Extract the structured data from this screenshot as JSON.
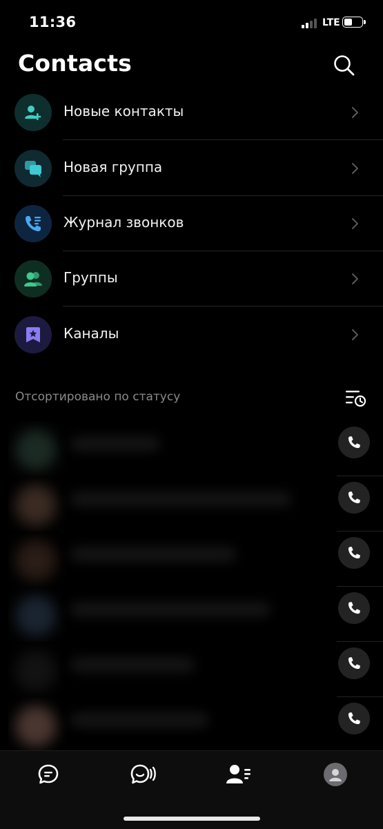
{
  "status_bar": {
    "time": "11:36",
    "network": "LTE",
    "battery_level": 0.4
  },
  "header": {
    "title": "Contacts",
    "search_icon": "search-icon"
  },
  "menu": {
    "items": [
      {
        "label": "Новые контакты",
        "icon": "add-contact-icon",
        "icon_color": "#3ecfc0",
        "bg": "#0f2e2e"
      },
      {
        "label": "Новая группа",
        "icon": "new-group-chat-icon",
        "icon_color": "#3ec9d6",
        "bg": "#0f2a30"
      },
      {
        "label": "Журнал звонков",
        "icon": "call-log-icon",
        "icon_color": "#4aa8f0",
        "bg": "#0e2540"
      },
      {
        "label": "Группы",
        "icon": "groups-icon",
        "icon_color": "#3ec98e",
        "bg": "#0f2e22"
      },
      {
        "label": "Каналы",
        "icon": "channels-icon",
        "icon_color": "#8a7cf0",
        "bg": "#1d1a40"
      }
    ]
  },
  "contacts_section": {
    "sort_label": "Отсортировано по статусу",
    "sort_icon": "sort-by-status-icon",
    "contacts": [
      {
        "avatar_color": "#1c2a24",
        "blurred": true
      },
      {
        "avatar_color": "#3a2a22",
        "blurred": true
      },
      {
        "avatar_color": "#2a1c16",
        "blurred": true
      },
      {
        "avatar_color": "#1a2430",
        "blurred": true
      },
      {
        "avatar_color": "#121212",
        "blurred": true
      },
      {
        "avatar_color": "#4a3630",
        "blurred": true
      }
    ]
  },
  "tab_bar": {
    "tabs": [
      {
        "icon": "chats-tab-icon",
        "active": false
      },
      {
        "icon": "voice-chat-tab-icon",
        "active": false
      },
      {
        "icon": "contacts-tab-icon",
        "active": true
      },
      {
        "icon": "profile-tab-icon",
        "active": false
      }
    ]
  },
  "colors": {
    "background": "#000000",
    "divider": "#262626",
    "secondary_text": "#8a8a8a"
  }
}
